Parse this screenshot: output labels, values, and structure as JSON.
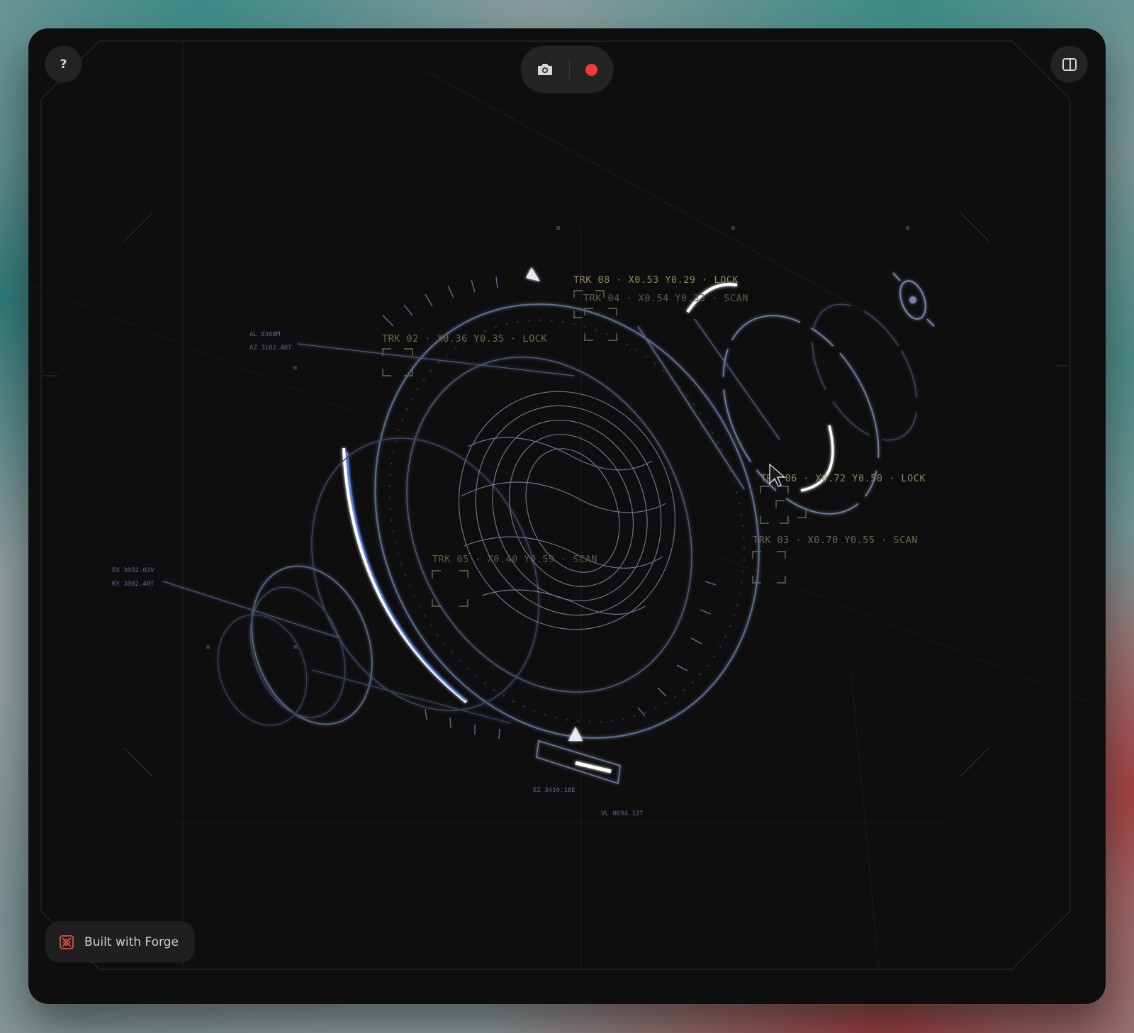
{
  "controls": {
    "help_label": "?",
    "camera_icon": "camera-icon",
    "record_icon": "record-icon",
    "panel_icon": "panel-toggle-icon"
  },
  "badge": {
    "label": "Built with Forge",
    "icon": "forge-logo-icon"
  },
  "hud": {
    "tracks": [
      {
        "id": "trk08",
        "text": "TRK 08 · X0.53 Y0.29 · LOCK"
      },
      {
        "id": "trk04",
        "text": "TRK 04 · X0.54 Y0.33 · SCAN"
      },
      {
        "id": "trk02",
        "text": "TRK 02 · X0.36 Y0.35 · LOCK"
      },
      {
        "id": "trk06",
        "text": "TRK 06 · X0.72 Y0.50 · LOCK"
      },
      {
        "id": "trk03",
        "text": "TRK 03 · X0.70 Y0.55 · SCAN"
      },
      {
        "id": "trk05",
        "text": "TRK 05 · X0.40 Y0.59 · SCAN"
      }
    ],
    "readouts": [
      {
        "id": "al",
        "text": "AL 6368M"
      },
      {
        "id": "az",
        "text": "AZ 3102.40T"
      },
      {
        "id": "ex",
        "text": "EX 3052.02V"
      },
      {
        "id": "ky",
        "text": "KY 3082.40T"
      },
      {
        "id": "ez",
        "text": "EZ 3410.18E"
      },
      {
        "id": "vl",
        "text": "VL 0694.12T"
      }
    ]
  },
  "colors": {
    "window_bg": "#0e0e0f",
    "hud_olive": "#8f8a56",
    "hud_blue": "#7a8fb8",
    "record": "#f23b3b",
    "badge_logo": "#e0503e"
  }
}
